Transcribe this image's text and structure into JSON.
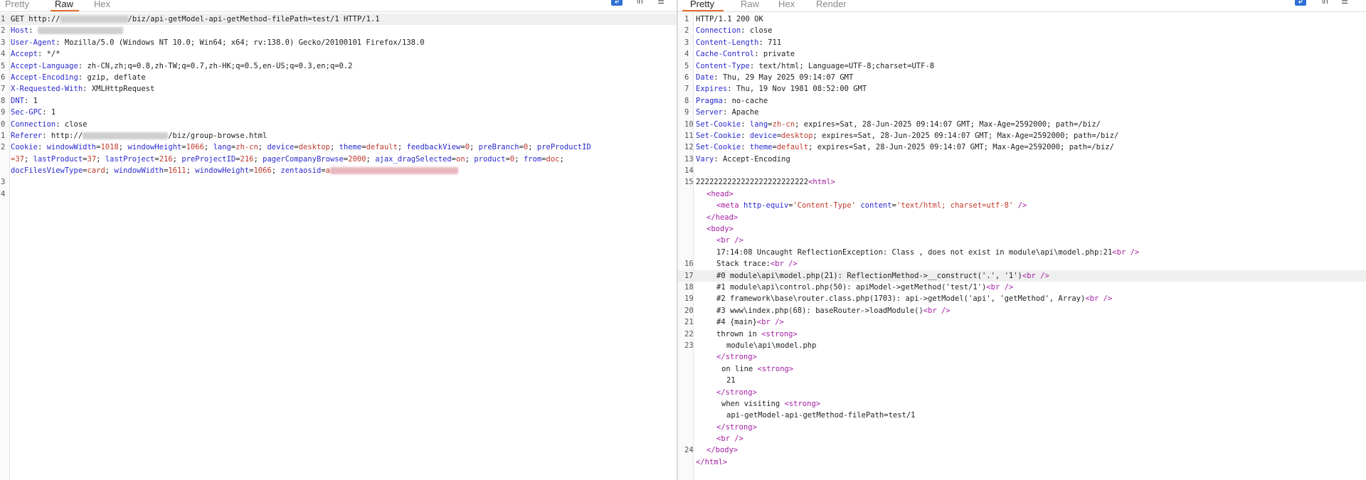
{
  "colors": {
    "accent_tab": "#e8702a",
    "header_name": "#2a2acf",
    "header_value": "#c0392b",
    "html_tag": "#a31ea3",
    "icon_selected": "#2f6fd6"
  },
  "request": {
    "tabs": [
      {
        "label": "Pretty"
      },
      {
        "label": "Raw"
      },
      {
        "label": "Hex"
      }
    ],
    "active_tab": "Raw",
    "toolbar_icons": [
      "wrap-icon",
      "newline-icon",
      "menu-icon"
    ],
    "lines": {
      "l1_pre": "GET http://",
      "l1_post": "/biz/api-getModel-api-getMethod-filePath=test/1 HTTP/1.1",
      "host": "Host",
      "ua_name": "User-Agent",
      "ua_val": "Mozilla/5.0 (Windows NT 10.0; Win64; x64; rv:138.0) Gecko/20100101 Firefox/138.0",
      "accept_name": "Accept",
      "accept_val": "*/*",
      "al_name": "Accept-Language",
      "al_val": "zh-CN,zh;q=0.8,zh-TW;q=0.7,zh-HK;q=0.5,en-US;q=0.3,en;q=0.2",
      "ae_name": "Accept-Encoding",
      "ae_val": "gzip, deflate",
      "xrw_name": "X-Requested-With",
      "xrw_val": "XMLHttpRequest",
      "dnt_name": "DNT",
      "dnt_val": "1",
      "gpc_name": "Sec-GPC",
      "gpc_val": "1",
      "conn_name": "Connection",
      "conn_val": "close",
      "ref_name": "Referer",
      "ref_pre": "http://",
      "ref_post": "/biz/group-browse.html",
      "cookie_name": "Cookie",
      "cookie_a": "windowWidth",
      "cookie_a_v": "1018",
      "cookie_b": "windowHeight",
      "cookie_b_v": "1066",
      "cookie_c": "lang",
      "cookie_c_v": "zh-cn",
      "cookie_d": "device",
      "cookie_d_v": "desktop",
      "cookie_e": "theme",
      "cookie_e_v": "default",
      "cookie_f": "feedbackView",
      "cookie_f_v": "0",
      "cookie_g": "preBranch",
      "cookie_g_v": "0",
      "cookie_h": "preProductID",
      "cookie2_h_v": "=37",
      "cookie2_i": "lastProduct",
      "cookie2_i_v": "37",
      "cookie2_j": "lastProject",
      "cookie2_j_v": "216",
      "cookie2_k": "preProjectID",
      "cookie2_k_v": "216",
      "cookie2_l": "pagerCompanyBrowse",
      "cookie2_l_v": "2000",
      "cookie2_m": "ajax_dragSelected",
      "cookie2_m_v": "on",
      "cookie2_n": "product",
      "cookie2_n_v": "0",
      "cookie2_o": "from",
      "cookie2_o_v": "doc",
      "cookie3_p": "docFilesViewType",
      "cookie3_p_v": "card",
      "cookie3_q": "windowWidth",
      "cookie3_q_v": "1611",
      "cookie3_r": "windowHeight",
      "cookie3_r_v": "1066",
      "cookie3_s": "zentaosid",
      "cookie3_s_v": "a"
    },
    "line_numbers": [
      "1",
      "2",
      "3",
      "4",
      "5",
      "6",
      "7",
      "8",
      "9",
      "0",
      "1",
      "2",
      "",
      "",
      "3",
      "4"
    ]
  },
  "response": {
    "tabs": [
      {
        "label": "Pretty"
      },
      {
        "label": "Raw"
      },
      {
        "label": "Hex"
      },
      {
        "label": "Render"
      }
    ],
    "active_tab": "Pretty",
    "toolbar_icons": [
      "wrap-icon",
      "newline-icon",
      "menu-icon"
    ],
    "line_numbers": [
      "1",
      "2",
      "3",
      "4",
      "5",
      "6",
      "7",
      "8",
      "9",
      "10",
      "11",
      "12",
      "13",
      "14",
      "15",
      "",
      "",
      "",
      "",
      "",
      "",
      "16",
      "17",
      "18",
      "19",
      "20",
      "21",
      "22",
      "23",
      "",
      "",
      "",
      "",
      "",
      "",
      "",
      "",
      "24",
      ""
    ],
    "lines": {
      "status": "HTTP/1.1 200 OK",
      "conn_name": "Connection",
      "conn_val": "close",
      "cl_name": "Content-Length",
      "cl_val": "711",
      "cc_name": "Cache-Control",
      "cc_val": "private",
      "ct_name": "Content-Type",
      "ct_val": "text/html; Language=UTF-8;charset=UTF-8",
      "date_name": "Date",
      "date_val": "Thu, 29 May 2025 09:14:07 GMT",
      "exp_name": "Expires",
      "exp_val": "Thu, 19 Nov 1981 08:52:00 GMT",
      "pragma_name": "Pragma",
      "pragma_val": "no-cache",
      "server_name": "Server",
      "server_val": "Apache",
      "sc_name": "Set-Cookie",
      "sc1_k": "lang",
      "sc1_v": "zh-cn",
      "sc1_rest": "; expires=Sat, 28-Jun-2025 09:14:07 GMT; Max-Age=2592000; path=/biz/",
      "sc2_k": "device",
      "sc2_v": "desktop",
      "sc2_rest": "; expires=Sat, 28-Jun-2025 09:14:07 GMT; Max-Age=2592000; path=/biz/",
      "sc3_k": "theme",
      "sc3_v": "default",
      "sc3_rest": "; expires=Sat, 28-Jun-2025 09:14:07 GMT; Max-Age=2592000; path=/biz/",
      "vary_name": "Vary",
      "vary_val": "Accept-Encoding",
      "b15_pre": "2222222222222222222222222",
      "tag_html": "<html>",
      "tag_head": "<head>",
      "meta_open": "<meta",
      "meta_a1": "http-equiv",
      "meta_v1": "'Content-Type'",
      "meta_a2": "content",
      "meta_v2": "'text/html; charset=utf-8'",
      "meta_close": "/>",
      "tag_head_close": "</head>",
      "tag_body": "<body>",
      "tag_br": "<br />",
      "b16": "17:14:08 Uncaught ReflectionException: Class , does not exist in module\\api\\model.php:21",
      "b17": "Stack trace:",
      "b18": "#0 module\\api\\model.php(21): ReflectionMethod->__construct('.', '1')",
      "b19": "#1 module\\api\\control.php(50): apiModel->getMethod('test/1')",
      "b20": "#2 framework\\base\\router.class.php(1703): api->getModel('api', 'getMethod', Array)",
      "b21": "#3 www\\index.php(68): baseRouter->loadModule()",
      "b22": "#4 {main}",
      "b23": "thrown in",
      "tag_strong": "<strong>",
      "tag_strong_close": "</strong>",
      "s1": "module\\api\\model.php",
      "on_line": "on line",
      "s2": "21",
      "when": "when visiting",
      "s3": "api-getModel-api-getMethod-filePath=test/1",
      "tag_body_close": "</body>",
      "tag_html_close": "</html>"
    }
  }
}
